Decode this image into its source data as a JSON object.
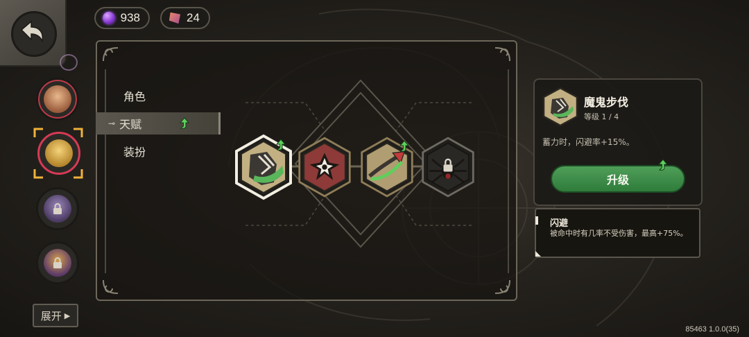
{
  "currencies": [
    {
      "icon": "purple-orb-icon",
      "value": "938"
    },
    {
      "icon": "crystal-shard-icon",
      "value": "24"
    }
  ],
  "tabs": [
    {
      "label": "角色",
      "active": false
    },
    {
      "label": "天赋",
      "active": true
    },
    {
      "label": "装扮",
      "active": false
    }
  ],
  "sidebar": {
    "expand_label": "展开",
    "characters": [
      {
        "name": "character-1",
        "locked": false
      },
      {
        "name": "character-2",
        "locked": false,
        "selected": true
      },
      {
        "name": "character-3",
        "locked": true
      },
      {
        "name": "character-4",
        "locked": true
      }
    ]
  },
  "talents": [
    {
      "icon": "claw-boot-icon",
      "upgradable": true,
      "selected": true
    },
    {
      "icon": "shuriken-icon",
      "upgradable": false
    },
    {
      "icon": "green-arrow-icon",
      "upgradable": true
    },
    {
      "icon": "spider-icon",
      "locked": true
    }
  ],
  "detail": {
    "title": "魔鬼步伐",
    "level": "等级 1 / 4",
    "description": "蓄力时，闪避率+15%。",
    "upgrade_label": "升级"
  },
  "tooltip": {
    "title": "闪避",
    "body": "被命中时有几率不受伤害，最高+75%。"
  },
  "version": "85463 1.0.0(35)",
  "colors": {
    "accent_green": "#4f9e58",
    "frame": "#6d675a",
    "highlight": "#e0b03a"
  }
}
